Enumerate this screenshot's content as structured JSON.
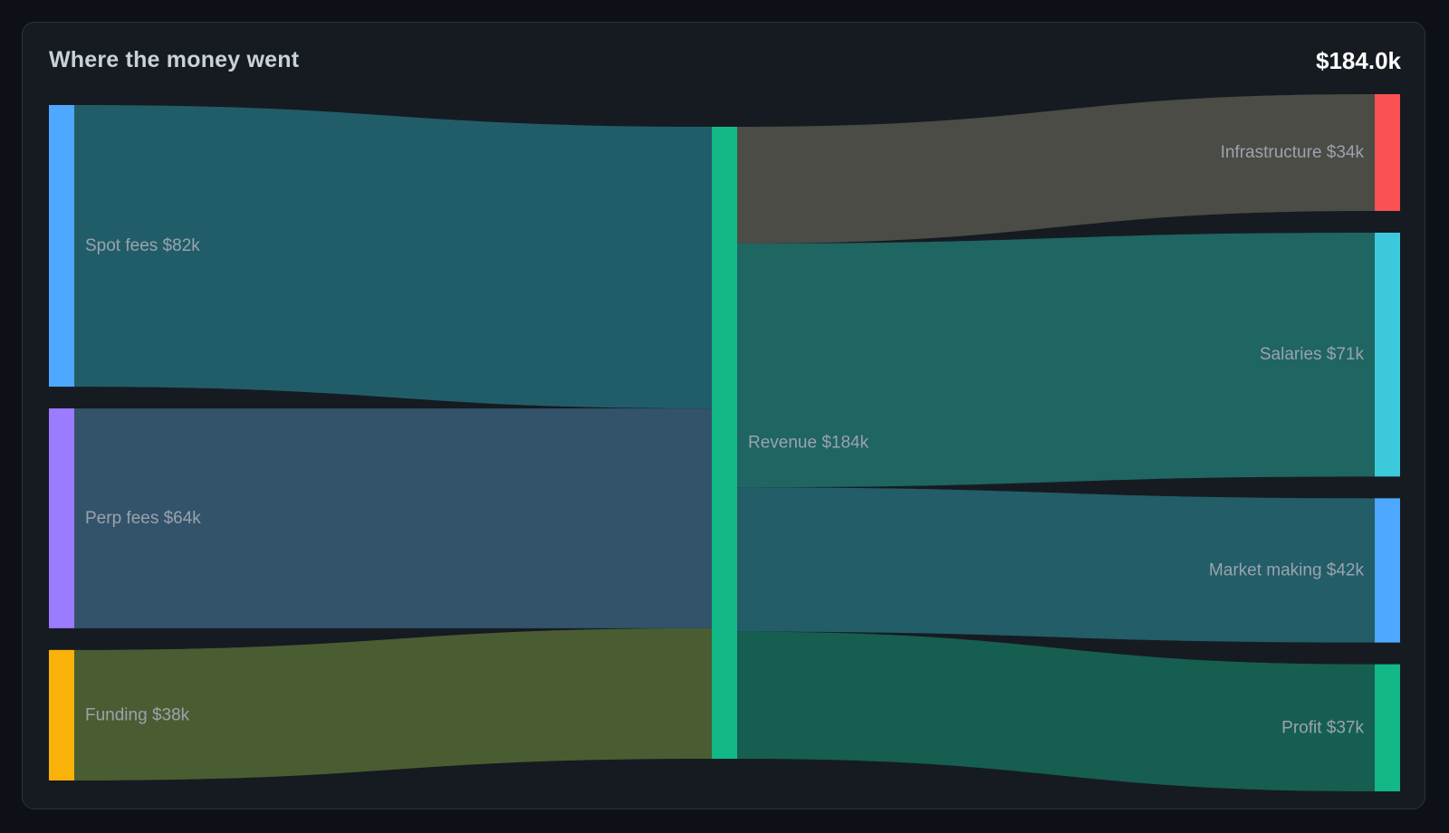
{
  "header": {
    "title": "Where the money went",
    "total": "$184.0k"
  },
  "chart_data": {
    "type": "sankey",
    "title": "Where the money went",
    "total_label": "$184.0k",
    "units": "thousand USD",
    "nodes": [
      {
        "id": "spot",
        "name": "Spot fees",
        "value": 82,
        "value_label": "$82k",
        "column": 0,
        "color": "#4ea8ff"
      },
      {
        "id": "perp",
        "name": "Perp fees",
        "value": 64,
        "value_label": "$64k",
        "column": 0,
        "color": "#9b7bff"
      },
      {
        "id": "funding",
        "name": "Funding",
        "value": 38,
        "value_label": "$38k",
        "column": 0,
        "color": "#f9b208"
      },
      {
        "id": "revenue",
        "name": "Revenue",
        "value": 184,
        "value_label": "$184k",
        "column": 1,
        "color": "#12b886"
      },
      {
        "id": "infra",
        "name": "Infrastructure",
        "value": 34,
        "value_label": "$34k",
        "column": 2,
        "color": "#fa5252"
      },
      {
        "id": "salaries",
        "name": "Salaries",
        "value": 71,
        "value_label": "$71k",
        "column": 2,
        "color": "#3bc9db"
      },
      {
        "id": "mm",
        "name": "Market making",
        "value": 42,
        "value_label": "$42k",
        "column": 2,
        "color": "#4ea8ff"
      },
      {
        "id": "profit",
        "name": "Profit",
        "value": 37,
        "value_label": "$37k",
        "column": 2,
        "color": "#12b886"
      }
    ],
    "links": [
      {
        "source": "spot",
        "target": "revenue",
        "value": 82,
        "color": "#215d68"
      },
      {
        "source": "perp",
        "target": "revenue",
        "value": 64,
        "color": "#32536a"
      },
      {
        "source": "funding",
        "target": "revenue",
        "value": 38,
        "color": "#4a5d32"
      },
      {
        "source": "revenue",
        "target": "infra",
        "value": 34,
        "color": "#4a4c45"
      },
      {
        "source": "revenue",
        "target": "salaries",
        "value": 71,
        "color": "#1f6561"
      },
      {
        "source": "revenue",
        "target": "mm",
        "value": 42,
        "color": "#225d68"
      },
      {
        "source": "revenue",
        "target": "profit",
        "value": 37,
        "color": "#165e50"
      }
    ]
  }
}
